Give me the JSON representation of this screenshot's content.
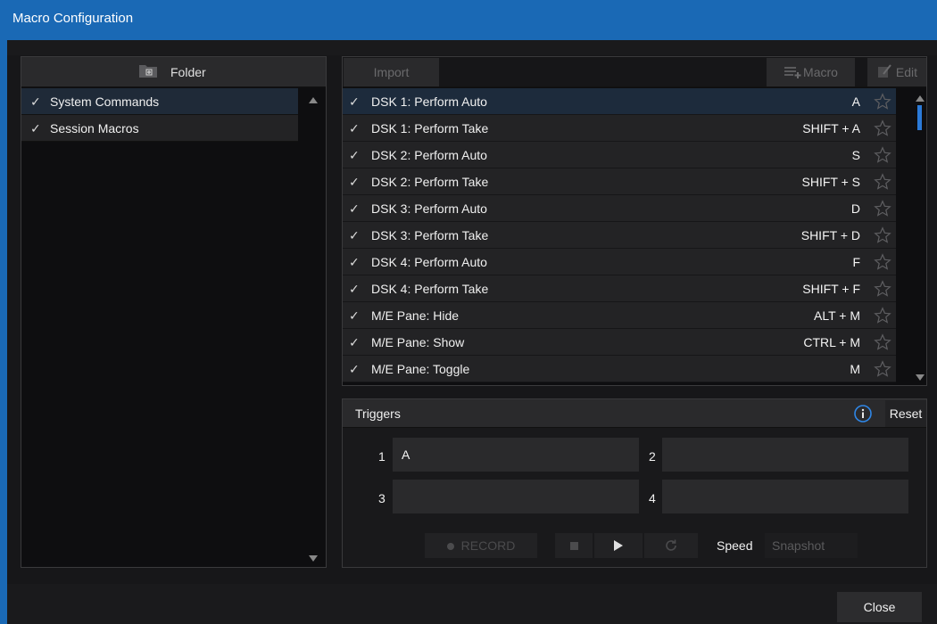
{
  "window": {
    "title": "Macro Configuration",
    "accent": "#1a69b5"
  },
  "folders": {
    "header_label": "Folder",
    "items": [
      {
        "check": "✓",
        "label": "System Commands",
        "selected": true
      },
      {
        "check": "✓",
        "label": "Session Macros",
        "selected": false
      }
    ]
  },
  "toolbar": {
    "import_label": "Import",
    "macro_label": "Macro",
    "edit_label": "Edit"
  },
  "macros": [
    {
      "check": "✓",
      "name": "DSK 1: Perform Auto",
      "key": "A",
      "selected": true
    },
    {
      "check": "✓",
      "name": "DSK 1: Perform Take",
      "key": "SHIFT + A"
    },
    {
      "check": "✓",
      "name": "DSK 2: Perform Auto",
      "key": "S"
    },
    {
      "check": "✓",
      "name": "DSK 2: Perform Take",
      "key": "SHIFT + S"
    },
    {
      "check": "✓",
      "name": "DSK 3: Perform Auto",
      "key": "D"
    },
    {
      "check": "✓",
      "name": "DSK 3: Perform Take",
      "key": "SHIFT + D"
    },
    {
      "check": "✓",
      "name": "DSK 4: Perform Auto",
      "key": "F"
    },
    {
      "check": "✓",
      "name": "DSK 4: Perform Take",
      "key": "SHIFT + F"
    },
    {
      "check": "✓",
      "name": "M/E Pane: Hide",
      "key": "ALT + M"
    },
    {
      "check": "✓",
      "name": "M/E Pane: Show",
      "key": "CTRL + M"
    },
    {
      "check": "✓",
      "name": "M/E Pane: Toggle",
      "key": "M"
    }
  ],
  "triggers": {
    "header_label": "Triggers",
    "reset_label": "Reset",
    "slots": [
      {
        "num": "1",
        "value": "A"
      },
      {
        "num": "2",
        "value": ""
      },
      {
        "num": "3",
        "value": ""
      },
      {
        "num": "4",
        "value": ""
      }
    ],
    "record_label": "RECORD",
    "speed_label": "Speed",
    "snapshot_label": "Snapshot"
  },
  "footer": {
    "close_label": "Close"
  }
}
